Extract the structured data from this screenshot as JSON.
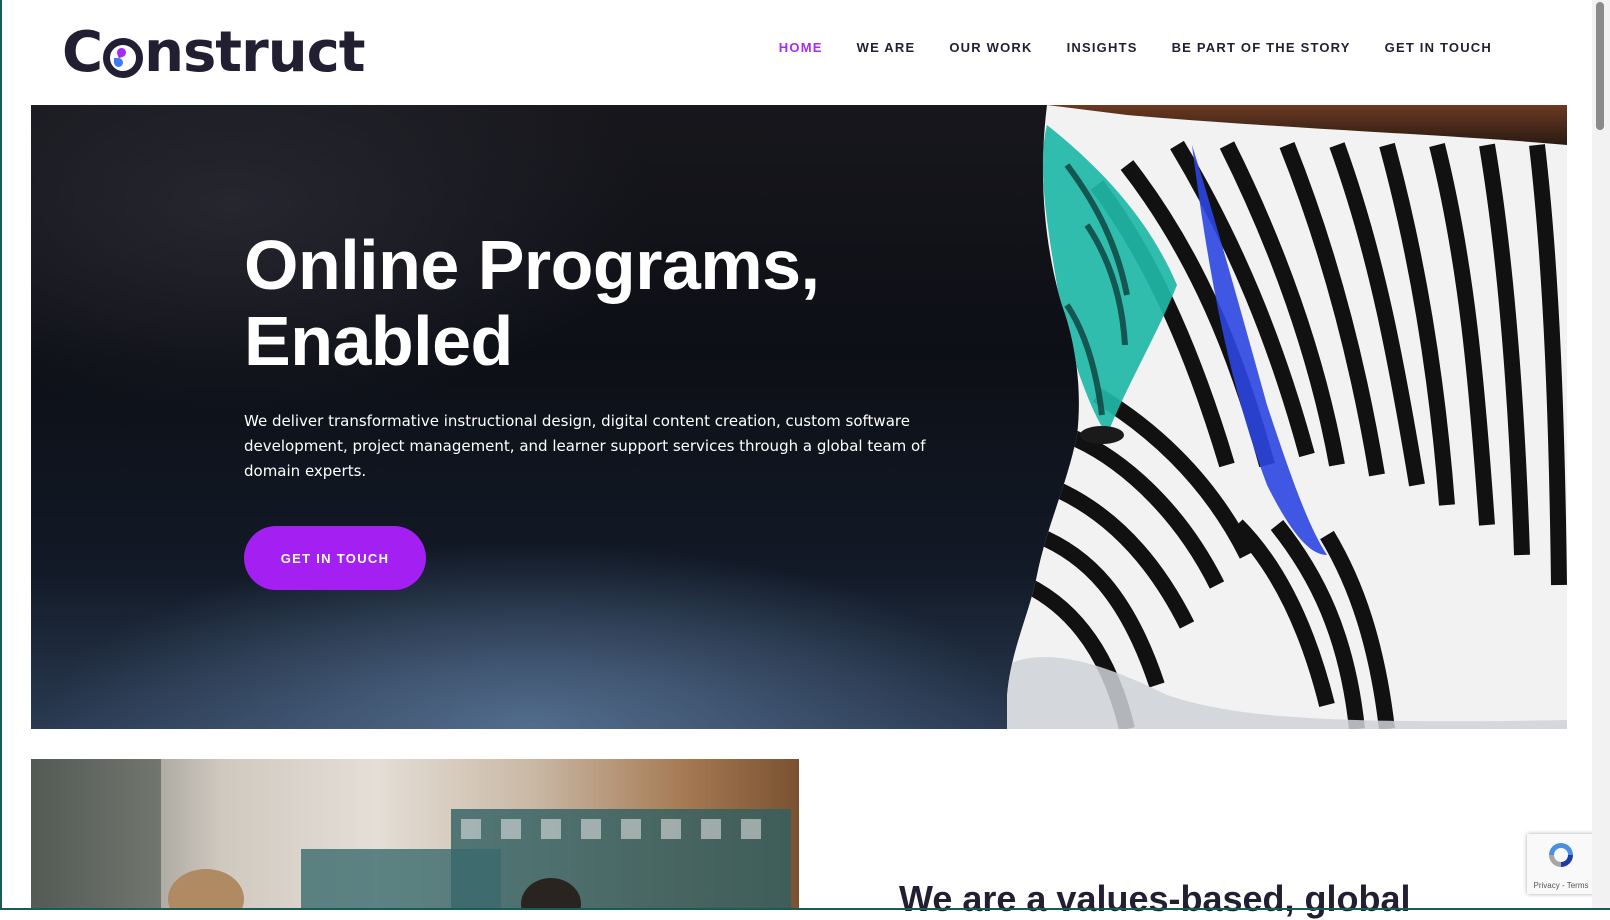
{
  "brand": {
    "logo_text_before": "C",
    "logo_text_after": "nstruct",
    "accent_color": "#a31ff2",
    "dark_color": "#231f33"
  },
  "nav": {
    "items": [
      {
        "label": "HOME",
        "active": true
      },
      {
        "label": "WE ARE",
        "active": false
      },
      {
        "label": "OUR WORK",
        "active": false
      },
      {
        "label": "INSIGHTS",
        "active": false
      },
      {
        "label": "BE PART OF THE STORY",
        "active": false
      },
      {
        "label": "GET IN TOUCH",
        "active": false
      }
    ]
  },
  "hero": {
    "title_line1": "Online Programs,",
    "title_line2": "Enabled",
    "description": "We deliver transformative instructional design, digital content creation, custom software development, project management, and learner support services through a global team of domain experts.",
    "cta_label": "GET IN TOUCH",
    "image": "zebra-photo"
  },
  "values": {
    "heading": "We are a values-based, global"
  },
  "recaptcha": {
    "label": "Privacy - Terms"
  }
}
